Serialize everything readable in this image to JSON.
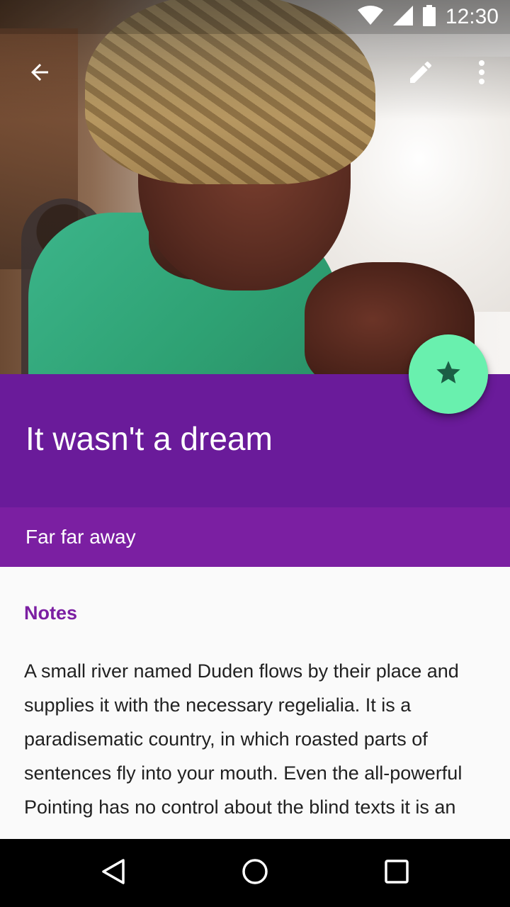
{
  "status_bar": {
    "time": "12:30",
    "icons": [
      "wifi-icon",
      "cell-signal-icon",
      "battery-icon"
    ]
  },
  "toolbar": {
    "back_icon": "arrow-back-icon",
    "edit_icon": "edit-pencil-icon",
    "overflow_icon": "more-vert-icon"
  },
  "hero": {
    "image_icon": "hero-photo"
  },
  "header": {
    "title": "It wasn't a dream",
    "subtitle": "Far far away"
  },
  "fab": {
    "icon": "star-icon"
  },
  "content": {
    "section_label": "Notes",
    "body": "A small river named Duden flows by their place and supplies it with the necessary regelialia. It is a paradisematic country, in which roasted parts of sentences fly into your mouth. Even the all-powerful Pointing has no control about the blind texts it is an"
  },
  "nav_bar": {
    "back_icon": "nav-back-icon",
    "home_icon": "nav-home-icon",
    "recents_icon": "nav-recents-icon"
  },
  "colors": {
    "primary": "#6a1b9a",
    "primary_light": "#7b1fa2",
    "accent": "#69f0ae",
    "status_bar": "#000000",
    "text": "#212121"
  }
}
